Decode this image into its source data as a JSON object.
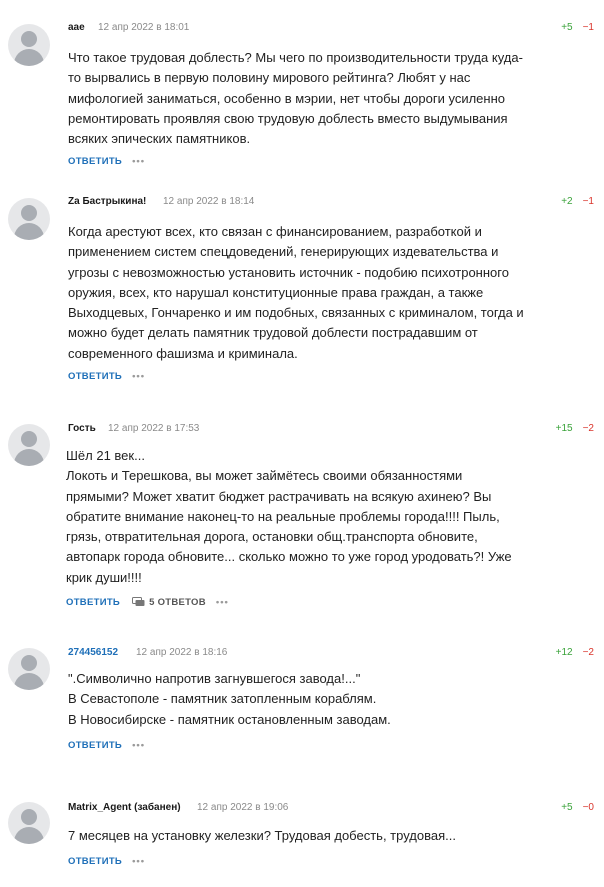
{
  "comments": [
    {
      "author": "aae",
      "date": "12 апр 2022 в 18:01",
      "plus": "+5",
      "minus": "−1",
      "lines": [
        "Что такое трудовая доблесть? Мы чего по производительности труда куда-",
        "то вырвались в первую половину мирового рейтинга? Любят у нас",
        "мифологией заниматься, особенно в мэрии, нет чтобы дороги усиленно",
        "ремонтировать проявляя свою трудовую доблесть вместо выдумывания",
        "всяких эпических памятников."
      ],
      "reply": "ОТВЕТИТЬ",
      "more": "•••"
    },
    {
      "author": "Za Бастрыкина!",
      "date": "12 апр 2022 в 18:14",
      "plus": "+2",
      "minus": "−1",
      "lines": [
        "Когда арестуют всех, кто связан с финансированием, разработкой и",
        "применением систем спецдоведений, генерирующих издевательства и",
        "угрозы с невозможностью установить источник - подобию психотронного",
        "оружия, всех, кто нарушал конституционные права граждан, а также",
        "Выходцевых, Гончаренко и им подобных, связанных с криминалом, тогда и",
        "можно будет делать памятник трудовой доблести пострадавшим от",
        "современного фашизма и криминала."
      ],
      "reply": "ОТВЕТИТЬ",
      "more": "•••"
    },
    {
      "author": "Гость",
      "date": "12 апр 2022 в 17:53",
      "plus": "+15",
      "minus": "−2",
      "lines": [
        "Шёл 21 век...",
        "Локоть и Терешкова, вы может займётесь своими обязанностями",
        "прямыми? Может хватит бюджет растрачивать на всякую ахинею? Вы",
        "обратите внимание наконец-то на реальные проблемы города!!!! Пыль,",
        "грязь, отвратительная дорога, остановки общ.транспорта обновите,",
        "автопарк города обновите... сколько можно то уже город уродовать?! Уже",
        "крик души!!!!"
      ],
      "reply": "ОТВЕТИТЬ",
      "answers": "5 ОТВЕТОВ",
      "more": "•••"
    },
    {
      "author": "274456152",
      "date": "12 апр 2022 в 18:16",
      "plus": "+12",
      "minus": "−2",
      "lines": [
        "\".Символично напротив загнувшегося завода!...\"",
        "В Севастополе - памятник затопленным кораблям.",
        "В Новосибирске - памятник остановленным заводам."
      ],
      "reply": "ОТВЕТИТЬ",
      "more": "•••"
    },
    {
      "author": "Matrix_Agent (забанен)",
      "date": "12 апр 2022 в 19:06",
      "plus": "+5",
      "minus": "−0",
      "lines": [
        "7 месяцев на установку железки? Трудовая добесть, трудовая..."
      ],
      "reply": "ОТВЕТИТЬ",
      "more": "•••"
    }
  ]
}
